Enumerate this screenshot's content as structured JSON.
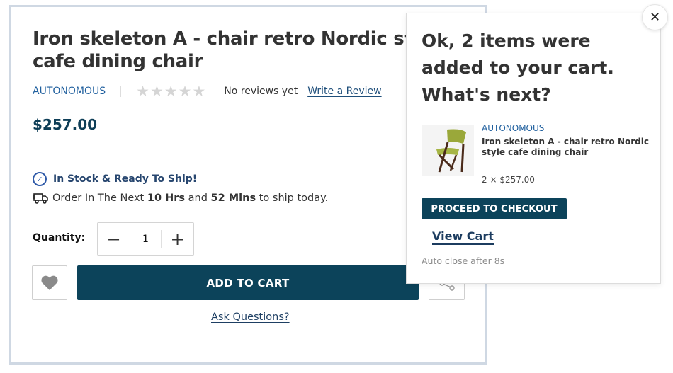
{
  "product": {
    "title_line1": "Iron skeleton A - chair retro Nordic style",
    "title_line2": "cafe dining chair",
    "brand": "AUTONOMOUS",
    "reviews_text": "No reviews yet",
    "write_review": "Write a Review",
    "rating_stars": 0,
    "rating_max": 5,
    "price": "$257.00",
    "stock_text": "In Stock & Ready To Ship!",
    "ship_prefix": "Order In The Next",
    "ship_hours": "10 Hrs",
    "ship_and": "and",
    "ship_mins": "52 Mins",
    "ship_suffix": "to ship today.",
    "quantity_label": "Quantity:",
    "quantity_value": "1",
    "minus_symbol": "−",
    "plus_symbol": "+",
    "add_to_cart": "ADD TO CART",
    "ask_questions": "Ask Questions?"
  },
  "popup": {
    "title": "Ok, 2 items were added to your cart. What's next?",
    "brand": "AUTONOMOUS",
    "product_name": "Iron skeleton A - chair retro Nordic style cafe dining chair",
    "quantity_price": "2 × $257.00",
    "checkout": "PROCEED TO CHECKOUT",
    "view_cart": "View Cart",
    "auto_close": "Auto close after 8s",
    "close_symbol": "✕"
  },
  "icons": {
    "wishlist": "heart-icon",
    "share": "share-icon",
    "stock": "check-circle-icon",
    "shipping": "truck-icon",
    "close": "close-icon"
  },
  "colors": {
    "primary_button": "#0c435a",
    "brand_link": "#1f5f9e",
    "price": "#0e3e57",
    "stock": "#27466f"
  }
}
